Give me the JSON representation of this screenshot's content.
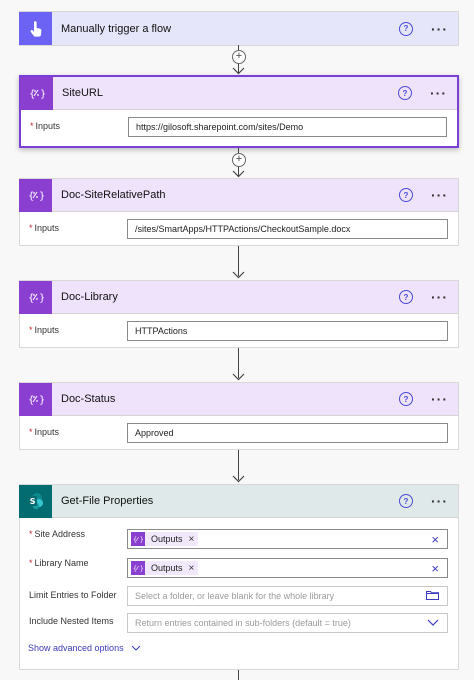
{
  "cards": [
    {
      "title": "Manually trigger a flow",
      "icon": "hand-pointer-icon"
    },
    {
      "title": "SiteURL",
      "icon": "compose-icon",
      "inputs_label": "Inputs",
      "inputs_value": "https://gilosoft.sharepoint.com/sites/Demo"
    },
    {
      "title": "Doc-SiteRelativePath",
      "icon": "compose-icon",
      "inputs_label": "Inputs",
      "inputs_value": "/sites/SmartApps/HTTPActions/CheckoutSample.docx"
    },
    {
      "title": "Doc-Library",
      "icon": "compose-icon",
      "inputs_label": "Inputs",
      "inputs_value": "HTTPActions"
    },
    {
      "title": "Doc-Status",
      "icon": "compose-icon",
      "inputs_label": "Inputs",
      "inputs_value": "Approved"
    },
    {
      "title": "Get-File Properties",
      "icon": "sharepoint-icon"
    }
  ],
  "getfile": {
    "site_address_label": "Site Address",
    "site_address_token": "Outputs",
    "library_name_label": "Library Name",
    "library_name_token": "Outputs",
    "limit_label": "Limit Entries to Folder",
    "limit_placeholder": "Select a folder, or leave blank for the whole library",
    "nested_label": "Include Nested Items",
    "nested_placeholder": "Return entries contained in sub-folders (default = true)",
    "advanced_label": "Show advanced options"
  },
  "common": {
    "help": "?",
    "more": "···",
    "required": "*",
    "plus": "+",
    "remove": "×"
  },
  "colors": {
    "compose": "#8a3fd0",
    "manual": "#6c63f5",
    "sharepoint": "#036c70",
    "accent": "#3b3bbf"
  }
}
